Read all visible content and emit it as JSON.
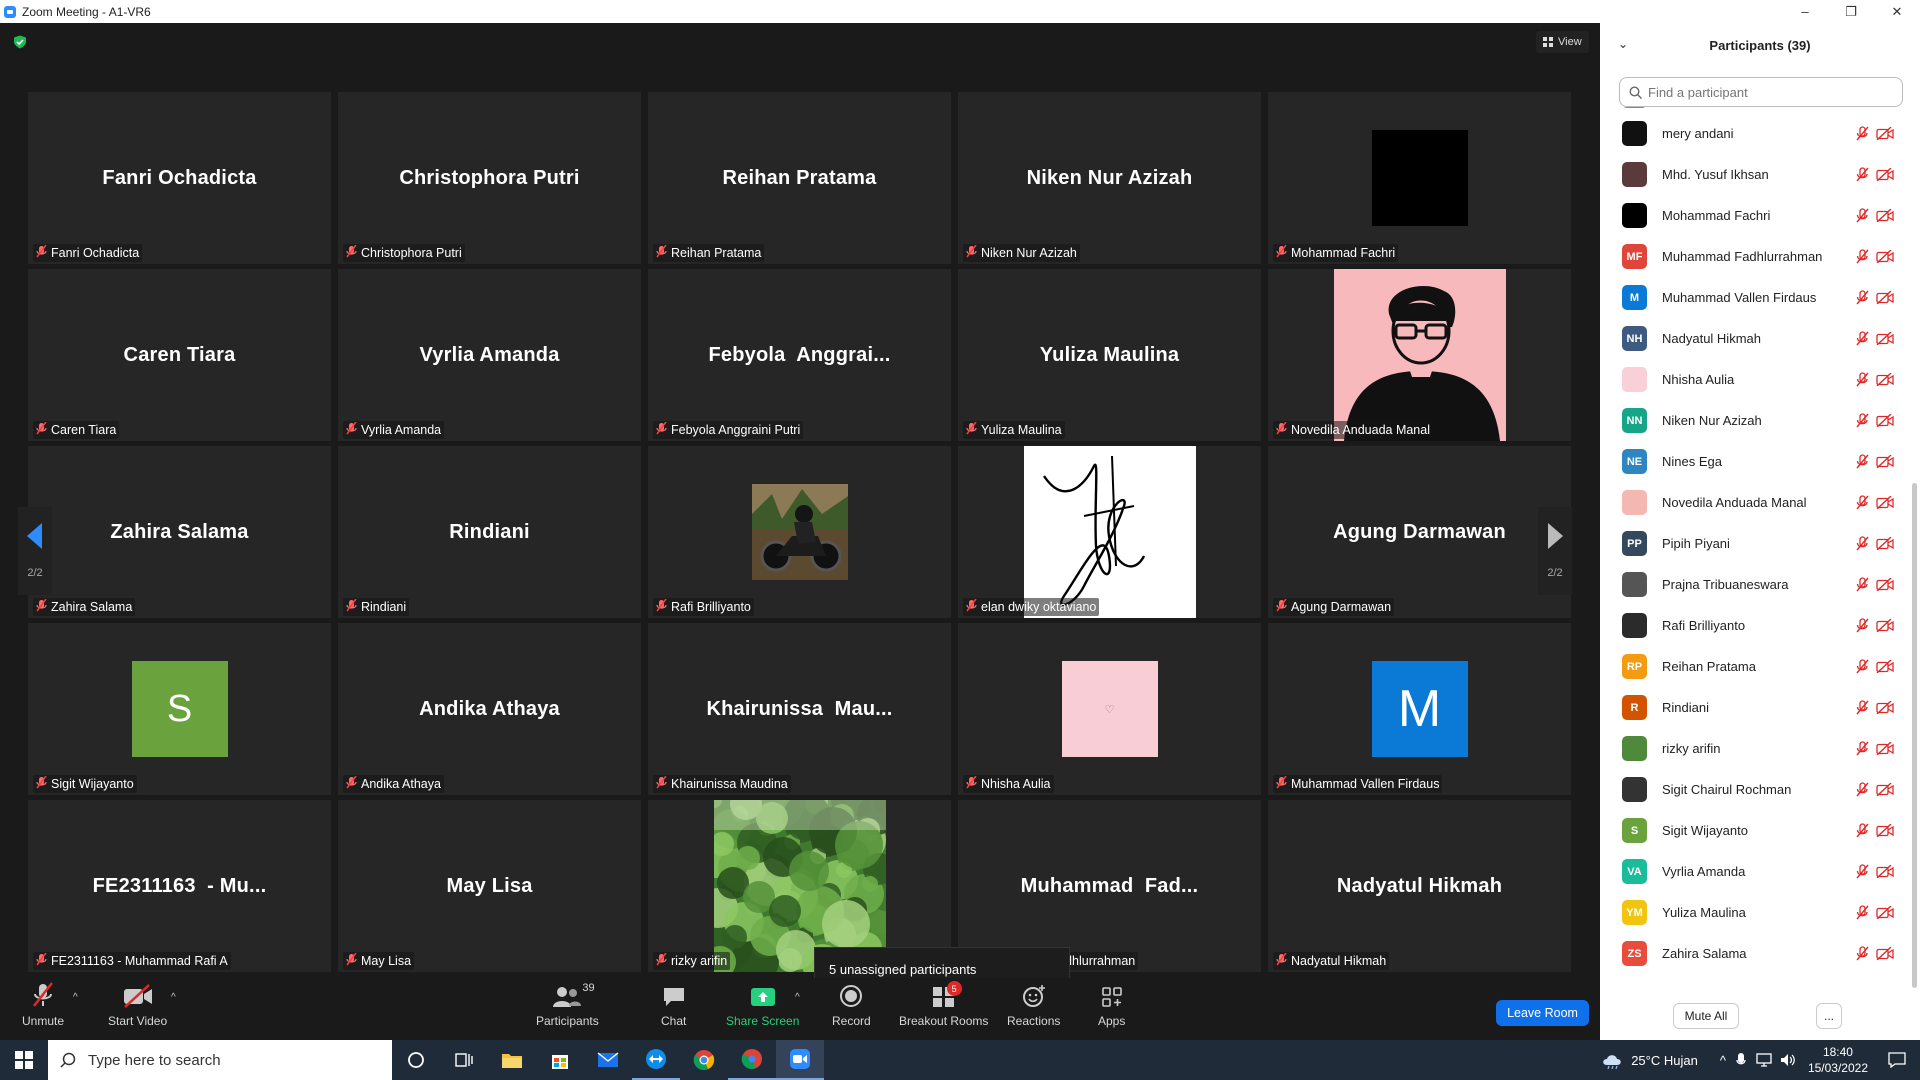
{
  "window": {
    "title": "Zoom Meeting - A1-VR6",
    "minimize": "–",
    "maximize": "❐",
    "close": "✕"
  },
  "view_label": "View",
  "page_indicator": {
    "left": "2/2",
    "right": "2/2"
  },
  "tiles": [
    {
      "display": "Fanri Ochadicta",
      "label": "Fanri Ochadicta"
    },
    {
      "display": "Christophora Putri",
      "label": "Christophora Putri"
    },
    {
      "display": "Reihan Pratama",
      "label": "Reihan Pratama"
    },
    {
      "display": "Niken Nur Azizah",
      "label": "Niken Nur Azizah"
    },
    {
      "display": "",
      "label": "Mohammad Fachri",
      "image": "black-square"
    },
    {
      "display": "Caren Tiara",
      "label": "Caren Tiara"
    },
    {
      "display": "Vyrlia Amanda",
      "label": "Vyrlia Amanda"
    },
    {
      "display": "Febyola  Anggrai...",
      "label": "Febyola Anggraini Putri"
    },
    {
      "display": "Yuliza Maulina",
      "label": "Yuliza Maulina"
    },
    {
      "display": "",
      "label": "Novedila Anduada Manal",
      "image": "avatar-glasses-pink"
    },
    {
      "display": "Zahira Salama",
      "label": "Zahira Salama"
    },
    {
      "display": "Rindiani",
      "label": "Rindiani"
    },
    {
      "display": "",
      "label": "Rafi Brilliyanto",
      "image": "motorbike-photo"
    },
    {
      "display": "",
      "label": "elan dwiky oktaviano",
      "image": "signature"
    },
    {
      "display": "Agung Darmawan",
      "label": "Agung Darmawan"
    },
    {
      "display": "",
      "label": "Sigit Wijayanto",
      "image": "letter-avatar",
      "letter": "S",
      "color": "#6aa33e"
    },
    {
      "display": "Andika Athaya",
      "label": "Andika Athaya"
    },
    {
      "display": "Khairunissa  Mau...",
      "label": "Khairunissa Maudina"
    },
    {
      "display": "",
      "label": "Nhisha Aulia",
      "image": "pink-heart",
      "letter": "♡"
    },
    {
      "display": "",
      "label": "Muhammad Vallen Firdaus",
      "image": "letter-avatar",
      "letter": "M",
      "color": "#0b79d6"
    },
    {
      "display": "FE2311163  - Mu...",
      "label": "FE2311163 - Muhammad Rafi A"
    },
    {
      "display": "May Lisa",
      "label": "May Lisa"
    },
    {
      "display": "",
      "label": "rizky arifin",
      "image": "foliage-photo"
    },
    {
      "display": "Muhammad  Fad...",
      "label": "Muhammad Fadhlurrahman"
    },
    {
      "display": "Nadyatul Hikmah",
      "label": "Nadyatul Hikmah"
    }
  ],
  "tooltip": "5 unassigned participants",
  "toolbar": {
    "unmute": "Unmute",
    "start_video": "Start Video",
    "participants": "Participants",
    "participants_count": "39",
    "chat": "Chat",
    "share_screen": "Share Screen",
    "record": "Record",
    "breakout_rooms": "Breakout Rooms",
    "breakout_badge": "5",
    "reactions": "Reactions",
    "apps": "Apps",
    "leave": "Leave Room"
  },
  "panel": {
    "title": "Participants (39)",
    "search_placeholder": "Find a participant",
    "mute_all": "Mute All",
    "more": "...",
    "participants": [
      {
        "name": "mery andani",
        "initials": "",
        "color": "#111111"
      },
      {
        "name": "Mhd. Yusuf Ikhsan",
        "initials": "",
        "color": "#5a3a3a"
      },
      {
        "name": "Mohammad Fachri",
        "initials": "",
        "color": "#000000"
      },
      {
        "name": "Muhammad Fadhlurrahman",
        "initials": "MF",
        "color": "#e0453a"
      },
      {
        "name": "Muhammad Vallen Firdaus",
        "initials": "M",
        "color": "#0b79d6"
      },
      {
        "name": "Nadyatul Hikmah",
        "initials": "NH",
        "color": "#3d5a80"
      },
      {
        "name": "Nhisha Aulia",
        "initials": "",
        "color": "#fad0d8"
      },
      {
        "name": "Niken Nur Azizah",
        "initials": "NN",
        "color": "#17a589"
      },
      {
        "name": "Nines Ega",
        "initials": "NE",
        "color": "#2e86c1"
      },
      {
        "name": "Novedila Anduada Manal",
        "initials": "",
        "color": "#f5b7b1"
      },
      {
        "name": "Pipih Piyani",
        "initials": "PP",
        "color": "#34495e"
      },
      {
        "name": "Prajna Tribuaneswara",
        "initials": "",
        "color": "#555555"
      },
      {
        "name": "Rafi Brilliyanto",
        "initials": "",
        "color": "#2b2b2b"
      },
      {
        "name": "Reihan Pratama",
        "initials": "RP",
        "color": "#f39c12"
      },
      {
        "name": "Rindiani",
        "initials": "R",
        "color": "#d35400"
      },
      {
        "name": "rizky arifin",
        "initials": "",
        "color": "#4e8a3a"
      },
      {
        "name": "Sigit Chairul Rochman",
        "initials": "",
        "color": "#333333"
      },
      {
        "name": "Sigit Wijayanto",
        "initials": "S",
        "color": "#6aa33e"
      },
      {
        "name": "Vyrlia Amanda",
        "initials": "VA",
        "color": "#1abc9c"
      },
      {
        "name": "Yuliza Maulina",
        "initials": "YM",
        "color": "#f1c40f"
      },
      {
        "name": "Zahira Salama",
        "initials": "ZS",
        "color": "#e74c3c"
      }
    ]
  },
  "taskbar": {
    "search_placeholder": "Type here to search",
    "weather": "25°C  Hujan",
    "time": "18:40",
    "date": "15/03/2022"
  },
  "colors": {
    "accent": "#0e71eb",
    "share_green": "#26d07c",
    "muted_red": "#e02828"
  }
}
